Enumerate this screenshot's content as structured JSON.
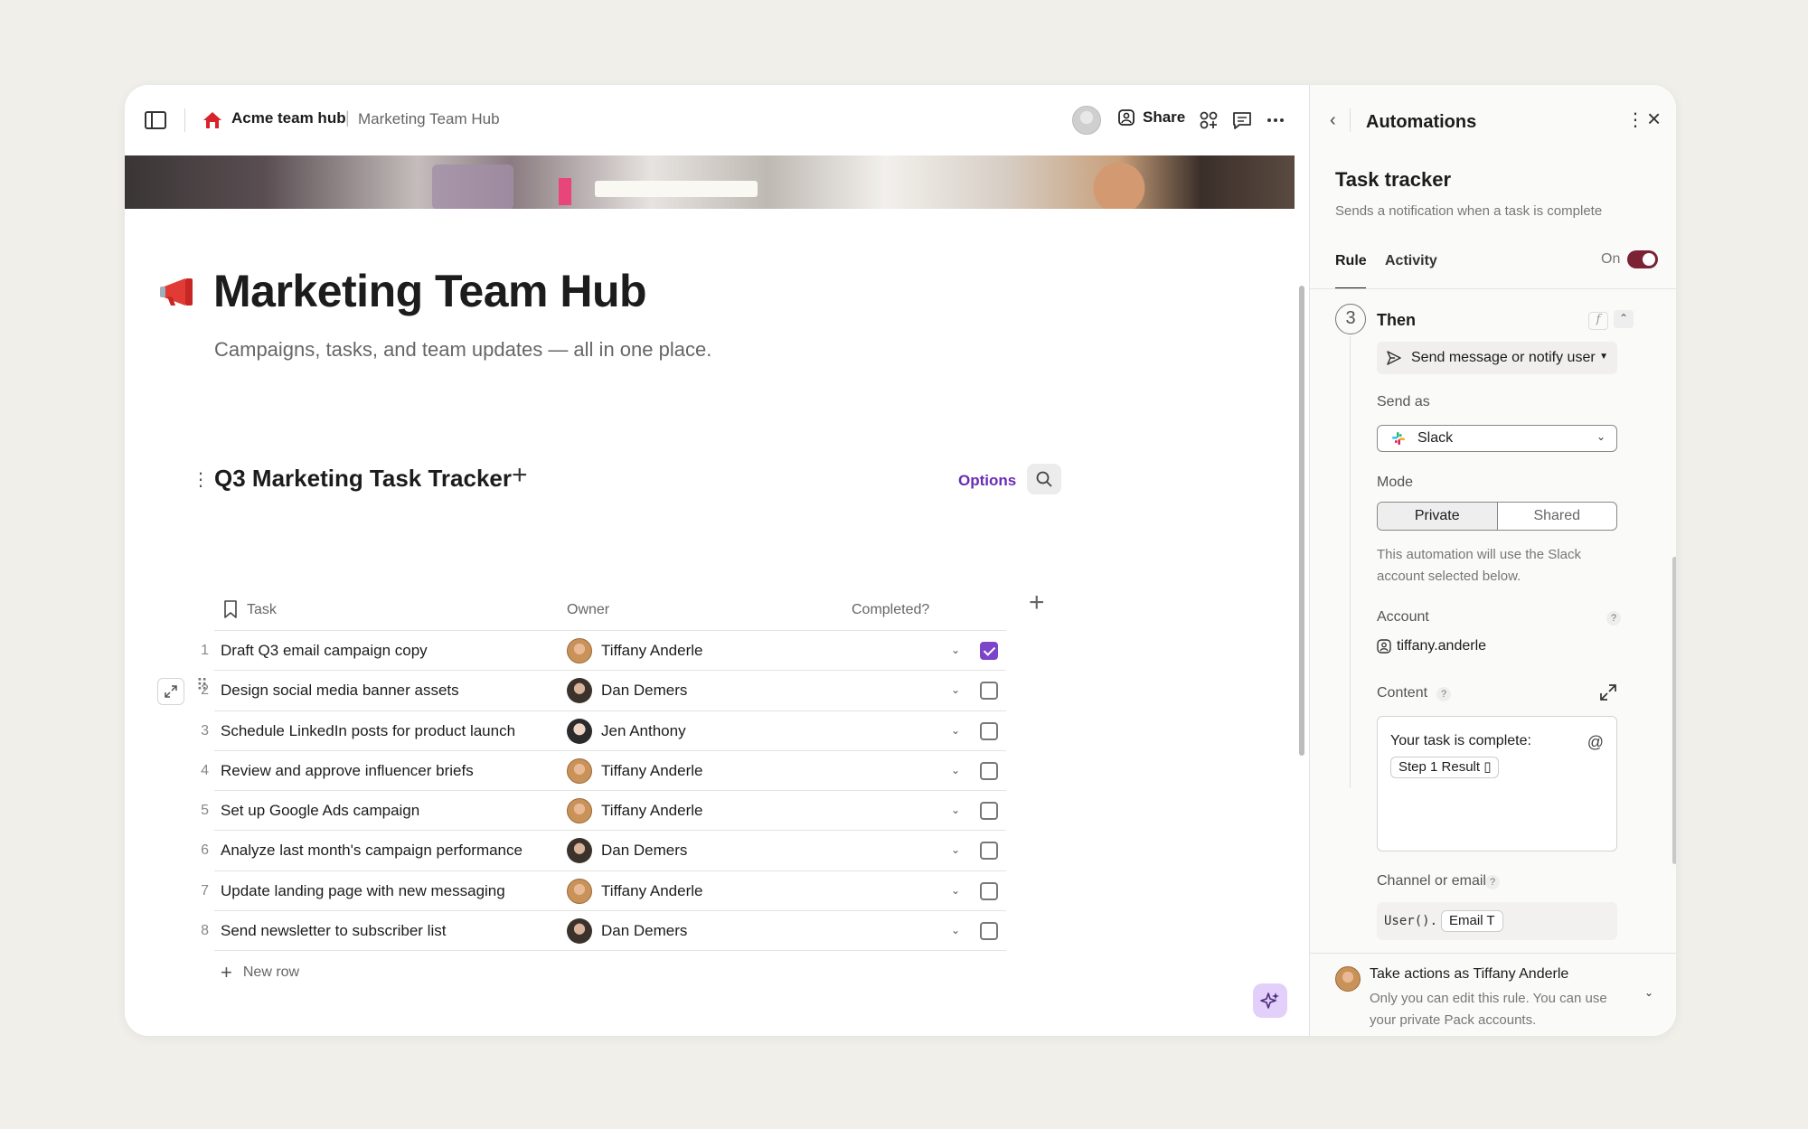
{
  "topbar": {
    "doc_name": "Acme team hub",
    "separator": "|",
    "page_name": "Marketing Team Hub",
    "share_label": "Share"
  },
  "page": {
    "title": "Marketing Team Hub",
    "subtitle": "Campaigns, tasks, and team updates — all in one place."
  },
  "table": {
    "title": "Q3 Marketing Task Tracker",
    "options_label": "Options",
    "columns": [
      "Task",
      "Owner",
      "Completed?"
    ],
    "rows": [
      {
        "num": "1",
        "task": "Draft Q3 email campaign copy",
        "owner": "Tiffany Anderle",
        "completed": true
      },
      {
        "num": "2",
        "task": "Design social media banner assets",
        "owner": "Dan Demers",
        "completed": false
      },
      {
        "num": "3",
        "task": "Schedule LinkedIn posts for product launch",
        "owner": "Jen Anthony",
        "completed": false
      },
      {
        "num": "4",
        "task": "Review and approve influencer briefs",
        "owner": "Tiffany Anderle",
        "completed": false
      },
      {
        "num": "5",
        "task": "Set up Google Ads campaign",
        "owner": "Tiffany Anderle",
        "completed": false
      },
      {
        "num": "6",
        "task": "Analyze last month's campaign performance",
        "owner": "Dan Demers",
        "completed": false
      },
      {
        "num": "7",
        "task": "Update landing page with new messaging",
        "owner": "Tiffany Anderle",
        "completed": false
      },
      {
        "num": "8",
        "task": "Send newsletter to subscriber list",
        "owner": "Dan Demers",
        "completed": false
      }
    ],
    "new_row_label": "New row"
  },
  "panel": {
    "title": "Automations",
    "rule_title": "Task tracker",
    "rule_desc": "Sends a notification when a task is complete",
    "tabs": [
      "Rule",
      "Activity"
    ],
    "toggle_label": "On",
    "step_number": "3",
    "step_label": "Then",
    "fx_label": "f",
    "action_label": "Send message or notify user",
    "send_as_label": "Send as",
    "send_as_value": "Slack",
    "mode_label": "Mode",
    "mode_options": [
      "Private",
      "Shared"
    ],
    "mode_selected": "Private",
    "mode_note": "This automation will use the Slack account selected below.",
    "account_label": "Account",
    "account_value": "tiffany.anderle",
    "content_label": "Content",
    "content_text": "Your task is complete:",
    "content_token": "Step 1 Result",
    "channel_label": "Channel or email",
    "channel_code": "User().",
    "channel_token": "Email",
    "help_mark": "?",
    "footer_title": "Take actions as Tiffany Anderle",
    "footer_desc": "Only you can edit this rule. You can use your private Pack accounts."
  },
  "colors": {
    "accent_purple": "#6a2bb6",
    "checkbox_checked": "#7c45c9",
    "toggle_on": "#7b2235",
    "ai_button_bg": "#e2d0fa"
  },
  "icons": [
    "sidebar-toggle-icon",
    "hub-icon",
    "share-icon",
    "apps-icon",
    "comment-icon",
    "more-icon",
    "megaphone-icon",
    "search-icon",
    "bookmark-icon",
    "expand-icon",
    "drag-handle-icon",
    "sparkle-icon",
    "back-icon",
    "kebab-icon",
    "close-icon",
    "send-icon",
    "slack-icon",
    "user-icon",
    "at-icon"
  ]
}
